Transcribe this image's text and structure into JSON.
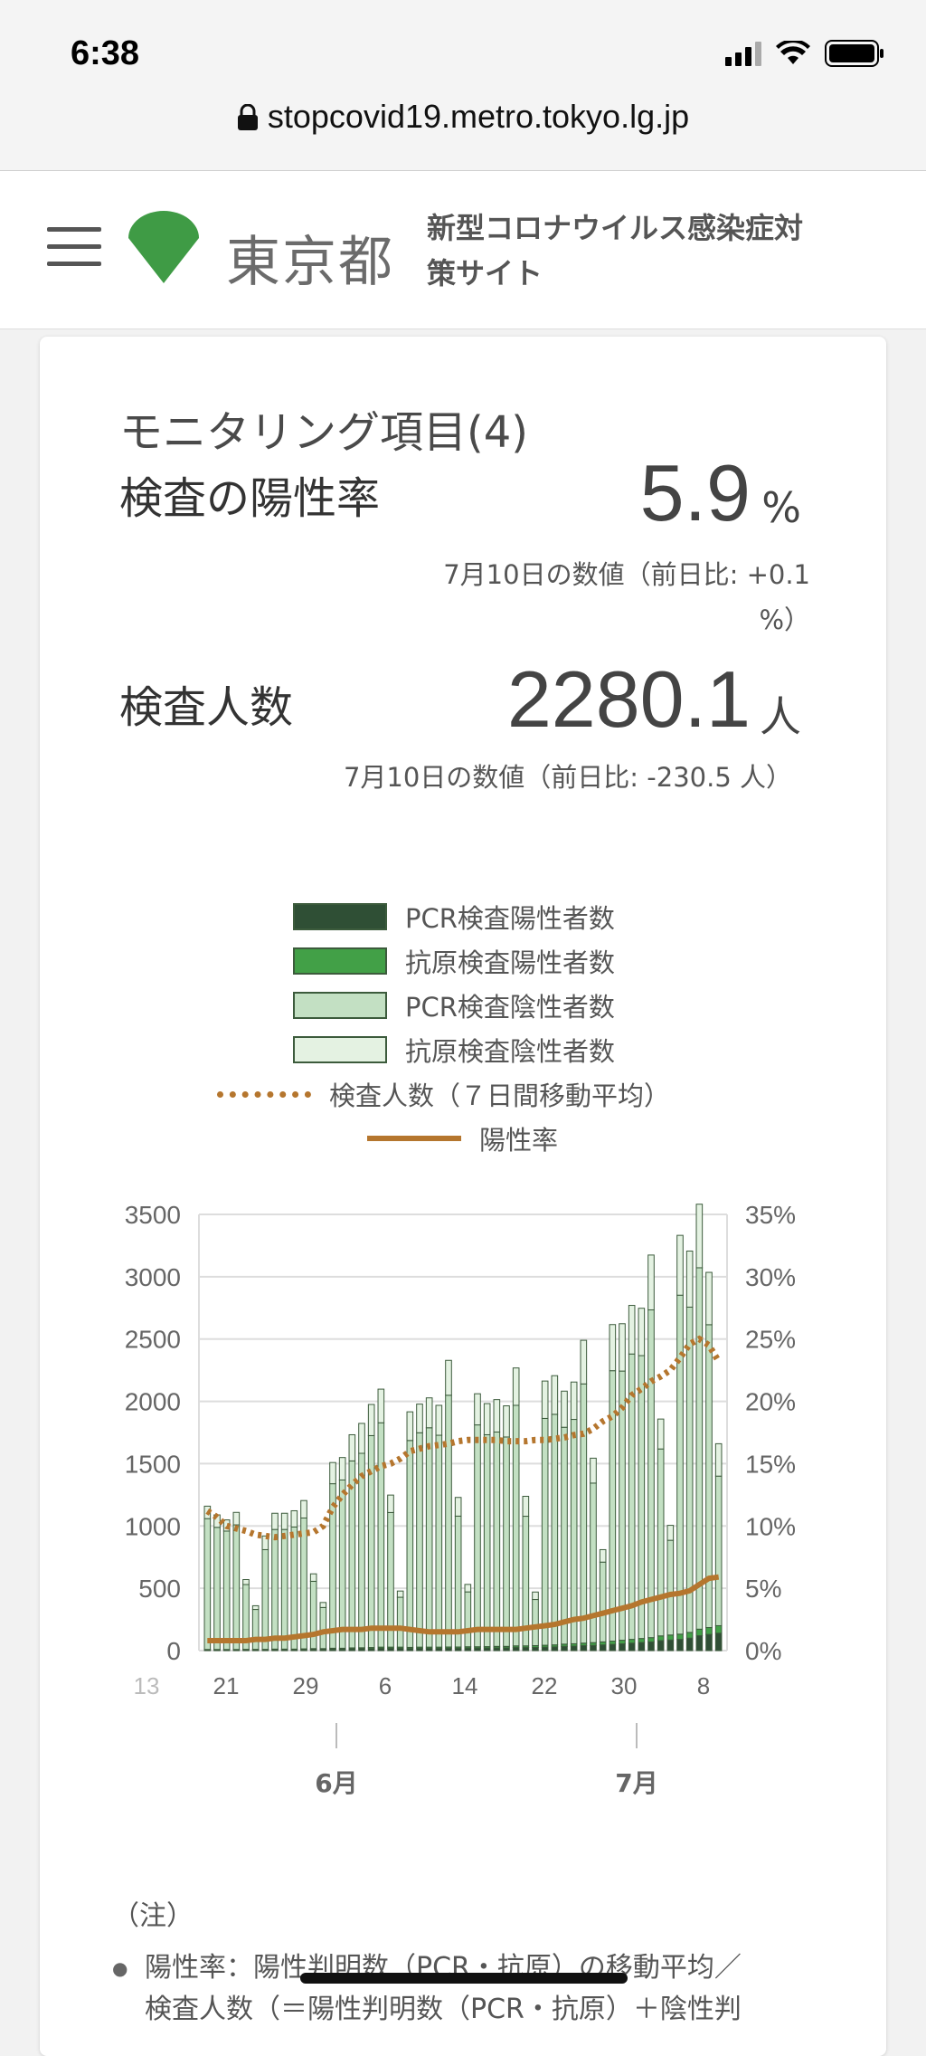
{
  "status_bar": {
    "time": "6:38",
    "url": "stopcovid19.metro.tokyo.lg.jp"
  },
  "header": {
    "logo_text": "東京都",
    "site_title": "新型コロナウイルス感染症対策サイト"
  },
  "card": {
    "subtitle": "モニタリング項目(4)",
    "metric1": {
      "label": "検査の陽性率",
      "value": "5.9",
      "unit": "%",
      "note": "7月10日の数値（前日比: +0.1 %）"
    },
    "metric2": {
      "label": "検査人数",
      "value": "2280.1",
      "unit": "人",
      "note": "7月10日の数値（前日比: -230.5 人）"
    }
  },
  "legend": [
    {
      "label": "PCR検査陽性者数",
      "color": "#2f4f35"
    },
    {
      "label": "抗原検査陽性者数",
      "color": "#42a047"
    },
    {
      "label": "PCR検査陰性者数",
      "color": "#c3e0c3"
    },
    {
      "label": "抗原検査陰性者数",
      "color": "#e4f2e2"
    },
    {
      "label": "検査人数（７日間移動平均）",
      "color": "#b5762e"
    },
    {
      "label": "陽性率",
      "color": "#b5762e"
    }
  ],
  "notes": {
    "heading": "（注）",
    "line1": "陽性率：陽性判明数（PCR・抗原）の移動平均／",
    "line2": "検査人数（＝陽性判明数（PCR・抗原）＋陰性判"
  },
  "chart_data": {
    "type": "bar",
    "title": "",
    "ylim": [
      0,
      3500
    ],
    "y2lim": [
      0,
      35
    ],
    "y_ticks": [
      "3500",
      "3000",
      "2500",
      "2000",
      "1500",
      "1000",
      "500",
      "0"
    ],
    "y2_ticks": [
      "35%",
      "30%",
      "25%",
      "20%",
      "15%",
      "10%",
      "5%",
      "0%"
    ],
    "x_tick_labels": [
      "13",
      "21",
      "29",
      "6",
      "14",
      "22",
      "30",
      "8"
    ],
    "month_labels": [
      "6月",
      "7月"
    ],
    "dates": [
      "5/18",
      "5/19",
      "5/20",
      "5/21",
      "5/22",
      "5/23",
      "5/24",
      "5/25",
      "5/26",
      "5/27",
      "5/28",
      "5/29",
      "5/30",
      "5/31",
      "6/1",
      "6/2",
      "6/3",
      "6/4",
      "6/5",
      "6/6",
      "6/7",
      "6/8",
      "6/9",
      "6/10",
      "6/11",
      "6/12",
      "6/13",
      "6/14",
      "6/15",
      "6/16",
      "6/17",
      "6/18",
      "6/19",
      "6/20",
      "6/21",
      "6/22",
      "6/23",
      "6/24",
      "6/25",
      "6/26",
      "6/27",
      "6/28",
      "6/29",
      "6/30",
      "7/1",
      "7/2",
      "7/3",
      "7/4",
      "7/5",
      "7/6",
      "7/7",
      "7/8",
      "7/9",
      "7/10"
    ],
    "series": [
      {
        "name": "PCR検査陽性者数",
        "axis": "left",
        "values": [
          5,
          5,
          5,
          5,
          6,
          6,
          6,
          7,
          7,
          7,
          8,
          10,
          10,
          12,
          12,
          14,
          15,
          16,
          18,
          18,
          18,
          17,
          18,
          18,
          18,
          19,
          19,
          20,
          20,
          21,
          22,
          22,
          25,
          25,
          26,
          28,
          30,
          34,
          36,
          40,
          42,
          46,
          50,
          55,
          60,
          65,
          70,
          80,
          85,
          90,
          100,
          120,
          130,
          140
        ]
      },
      {
        "name": "抗原検査陽性者数",
        "axis": "left",
        "values": [
          4,
          4,
          4,
          4,
          4,
          4,
          4,
          5,
          5,
          5,
          6,
          6,
          6,
          7,
          7,
          8,
          8,
          9,
          10,
          10,
          10,
          9,
          10,
          10,
          10,
          10,
          10,
          11,
          11,
          11,
          12,
          12,
          13,
          13,
          14,
          15,
          16,
          18,
          19,
          20,
          22,
          24,
          26,
          28,
          30,
          32,
          34,
          38,
          40,
          42,
          46,
          52,
          55,
          60
        ]
      },
      {
        "name": "PCR検査陰性者数",
        "axis": "left",
        "values": [
          1050,
          980,
          950,
          1000,
          520,
          320,
          800,
          960,
          960,
          980,
          1050,
          540,
          330,
          1320,
          1350,
          1500,
          1560,
          1700,
          1800,
          1080,
          400,
          1660,
          1720,
          1760,
          1700,
          2020,
          1050,
          440,
          1780,
          1700,
          1720,
          1680,
          1930,
          1040,
          370,
          1820,
          1850,
          1740,
          1800,
          2080,
          1280,
          640,
          2170,
          2160,
          2290,
          2270,
          2630,
          1500,
          760,
          2720,
          2610,
          2900,
          2430,
          1200
        ]
      },
      {
        "name": "抗原検査陰性者数",
        "axis": "left",
        "values": [
          100,
          100,
          90,
          100,
          40,
          30,
          110,
          130,
          130,
          130,
          140,
          60,
          40,
          170,
          180,
          210,
          240,
          250,
          270,
          140,
          50,
          230,
          230,
          240,
          240,
          280,
          150,
          60,
          250,
          250,
          260,
          250,
          300,
          160,
          60,
          300,
          310,
          290,
          300,
          350,
          200,
          100,
          370,
          380,
          390,
          380,
          440,
          240,
          120,
          480,
          450,
          510,
          420,
          260
        ]
      },
      {
        "name": "検査人数（７日間移動平均）",
        "axis": "left",
        "values": [
          1120,
          1070,
          1000,
          980,
          960,
          930,
          920,
          910,
          920,
          930,
          940,
          950,
          1000,
          1150,
          1250,
          1330,
          1400,
          1440,
          1480,
          1500,
          1540,
          1600,
          1620,
          1640,
          1650,
          1660,
          1680,
          1690,
          1690,
          1690,
          1690,
          1680,
          1680,
          1680,
          1690,
          1690,
          1700,
          1710,
          1730,
          1740,
          1780,
          1840,
          1880,
          1950,
          2050,
          2100,
          2160,
          2200,
          2250,
          2350,
          2460,
          2500,
          2450,
          2320
        ]
      },
      {
        "name": "陽性率",
        "axis": "right",
        "values": [
          0.8,
          0.8,
          0.8,
          0.8,
          0.8,
          0.9,
          0.9,
          1.0,
          1.0,
          1.1,
          1.2,
          1.3,
          1.5,
          1.6,
          1.7,
          1.7,
          1.7,
          1.8,
          1.8,
          1.8,
          1.8,
          1.7,
          1.6,
          1.5,
          1.5,
          1.5,
          1.5,
          1.6,
          1.7,
          1.7,
          1.7,
          1.7,
          1.7,
          1.8,
          1.9,
          2.0,
          2.1,
          2.3,
          2.5,
          2.6,
          2.8,
          3.0,
          3.2,
          3.4,
          3.6,
          3.9,
          4.1,
          4.3,
          4.5,
          4.6,
          4.8,
          5.3,
          5.8,
          5.9
        ]
      }
    ]
  }
}
